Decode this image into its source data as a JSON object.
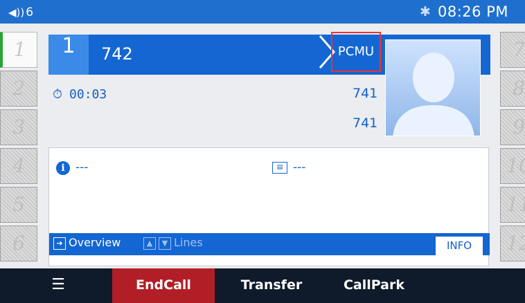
{
  "status": {
    "volume_icon": "speaker-volume-icon",
    "volume_level": "6",
    "bluetooth_icon": "bluetooth-icon",
    "time": "08:26 PM"
  },
  "line_keys_left": [
    "1",
    "2",
    "3",
    "4",
    "5",
    "6"
  ],
  "line_keys_right": [
    "7",
    "8",
    "9",
    "10",
    "11",
    "12"
  ],
  "call": {
    "line": "1",
    "number": "742",
    "codec": "PCMU",
    "duration": "00:03",
    "remote_1": "741",
    "remote_2": "741"
  },
  "info": {
    "field_1": "---",
    "field_2": "---"
  },
  "tabs": {
    "overview": "Overview",
    "lines": "Lines",
    "info": "INFO"
  },
  "softkeys": {
    "endcall": "EndCall",
    "transfer": "Transfer",
    "callpark": "CallPark"
  },
  "colors": {
    "accent": "#1466d2",
    "status_bar": "#1f6fcf",
    "endcall": "#b21e26",
    "active_line": "#2aa335",
    "codec_highlight": "#e33333"
  }
}
